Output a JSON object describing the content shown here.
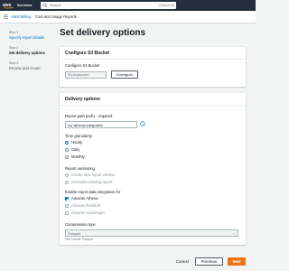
{
  "topnav": {
    "services_label": "Services",
    "search": {
      "placeholder": "Search",
      "hint": "[Option+S]"
    }
  },
  "breadcrumb": {
    "items": [
      "AWS Billing",
      "Cost and Usage Reports"
    ],
    "separator": "›"
  },
  "steps": [
    {
      "num": "Step 1",
      "title": "Specify report details",
      "state": "link"
    },
    {
      "num": "Step 2",
      "title": "Set delivery options",
      "state": "active"
    },
    {
      "num": "Step 3",
      "title": "Review and create",
      "state": "disabled"
    }
  ],
  "page_title": "Set delivery options",
  "s3_card": {
    "title": "Configure S3 Bucket",
    "field_label": "Configure S3 Bucket",
    "bucket_value": "S3://mybucket",
    "configure_button": "Configure"
  },
  "delivery_card": {
    "title": "Delivery options",
    "prefix_label": "Report path prefix - required",
    "prefix_value": "cur-athena-integration",
    "time_granularity_label": "Time granularity",
    "granularity_options": [
      {
        "label": "Hourly",
        "selected": true,
        "disabled": false
      },
      {
        "label": "Daily",
        "selected": false,
        "disabled": false
      },
      {
        "label": "Monthly",
        "selected": false,
        "disabled": false
      }
    ],
    "versioning_label": "Report versioning",
    "versioning_options": [
      {
        "label": "Create new report version",
        "selected": false,
        "disabled": true
      },
      {
        "label": "Overwrite existing report",
        "selected": true,
        "disabled": true
      }
    ],
    "integration_label": "Enable report data integration for",
    "integration_options": [
      {
        "label": "Amazon Athena",
        "checked": true,
        "disabled": false
      },
      {
        "label": "Amazon Redshift",
        "checked": false,
        "disabled": true
      },
      {
        "label": "Amazon QuickSight",
        "checked": false,
        "disabled": true
      }
    ],
    "compression_label": "Compression type",
    "compression_value": "Parquet",
    "file_format": "File Format: Parquet"
  },
  "footer": {
    "cancel": "Cancel",
    "previous": "Previous",
    "next": "Next"
  },
  "colors": {
    "nav_bg": "#232f3e",
    "link": "#0073bb",
    "primary_button": "#ec7211",
    "page_bg": "#f2f3f3"
  }
}
